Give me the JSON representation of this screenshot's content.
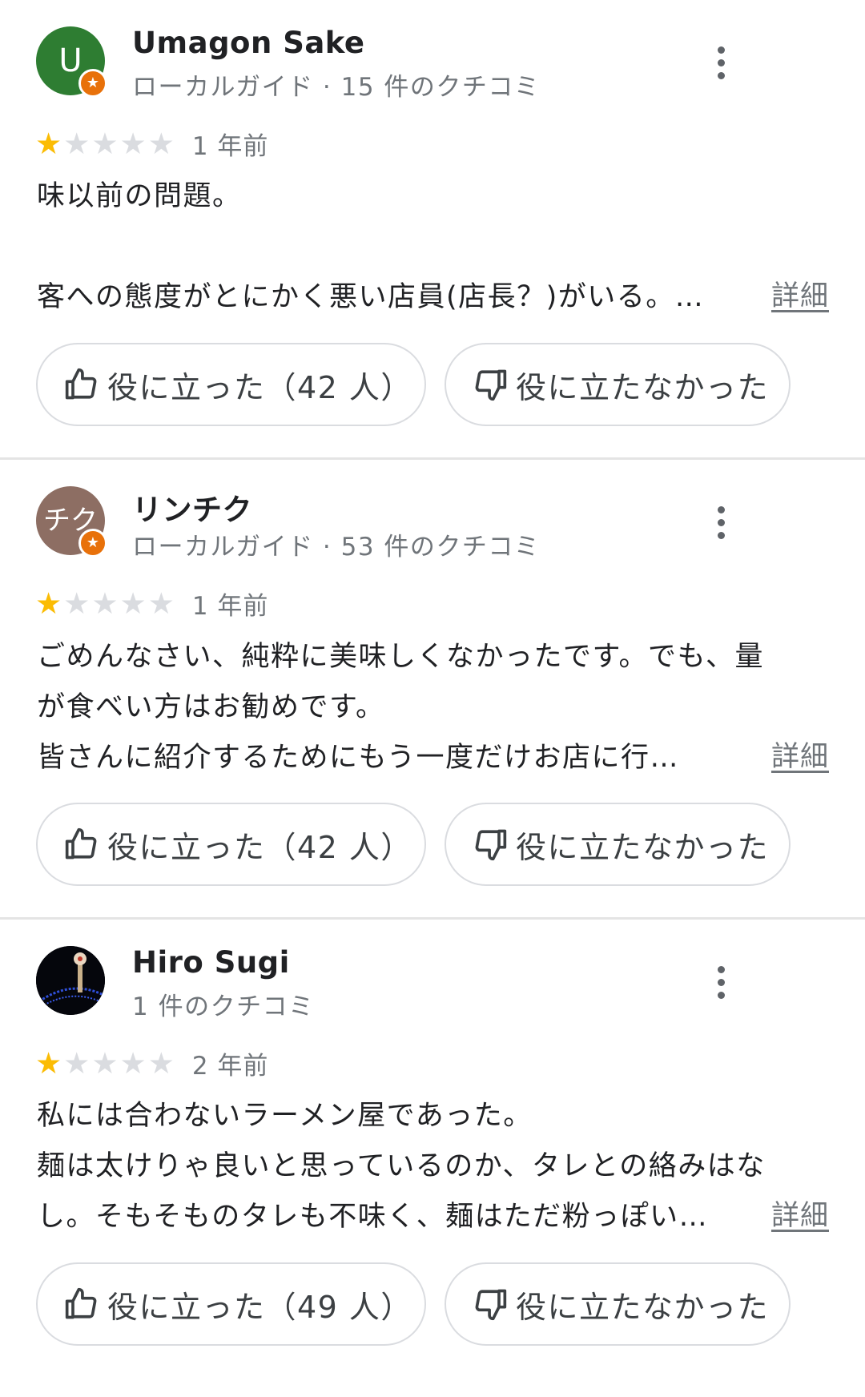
{
  "reviews": [
    {
      "author": "Umagon Sake",
      "avatar_text": "U",
      "meta": "ローカルガイド · 15 件のクチコミ",
      "rating": 1,
      "time": "1 年前",
      "lines": [
        "味以前の問題。",
        "",
        "客への態度がとにかく悪い店員(店長？)がいる。…"
      ],
      "detail_label": "詳細",
      "helpful_label": "役に立った（42 人）",
      "unhelpful_label": "役に立たなかった"
    },
    {
      "author": "リンチク",
      "avatar_text": "チク",
      "meta": "ローカルガイド · 53 件のクチコミ",
      "rating": 1,
      "time": "1 年前",
      "lines": [
        "ごめんなさい、純粋に美味しくなかったです。でも、量",
        "が食べい方はお勧めです。",
        "皆さんに紹介するためにもう一度だけお店に行…"
      ],
      "detail_label": "詳細",
      "helpful_label": "役に立った（42 人）",
      "unhelpful_label": "役に立たなかった"
    },
    {
      "author": "Hiro Sugi",
      "meta": "1 件のクチコミ",
      "rating": 1,
      "time": "2 年前",
      "lines": [
        "私には合わないラーメン屋であった。",
        "麺は太けりゃ良いと思っているのか、タレとの絡みはな",
        "し。そもそものタレも不味く、麺はただ粉っぽい…"
      ],
      "detail_label": "詳細",
      "helpful_label": "役に立った（49 人）",
      "unhelpful_label": "役に立たなかった"
    }
  ],
  "colors": {
    "star_filled": "#fbbc04",
    "star_empty": "#dadce0",
    "guide_badge": "#e8710a",
    "avatar_1": "#2e7d32",
    "avatar_2": "#8d6e63"
  },
  "icons": [
    "more-vert-icon",
    "star-icon",
    "local-guide-badge-icon",
    "thumb-up-icon",
    "thumb-down-icon"
  ]
}
